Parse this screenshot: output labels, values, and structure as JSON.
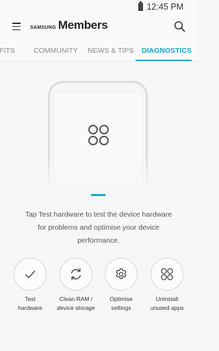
{
  "status_bar": {
    "time": "12:45 PM",
    "battery_icon": "battery-icon"
  },
  "app_bar": {
    "brand_small": "SAMSUNG",
    "brand_big": "Members",
    "menu_icon": "menu-icon",
    "search_icon": "search-icon"
  },
  "tabs": [
    {
      "label": "EFITS",
      "active": false
    },
    {
      "label": "COMMUNITY",
      "active": false
    },
    {
      "label": "NEWS & TIPS",
      "active": false
    },
    {
      "label": "DIAGNOSTICS",
      "active": true
    }
  ],
  "colors": {
    "accent": "#1ba8c8"
  },
  "main": {
    "illustration_icon": "apps-grid-icon",
    "description": "Tap Test hardware to test the device hardware for problems and optimise your device performance."
  },
  "actions": [
    {
      "icon": "check-icon",
      "label_lines": [
        "Test",
        "hardware"
      ]
    },
    {
      "icon": "refresh-icon",
      "label_lines": [
        "Clean RAM /",
        "device storage"
      ]
    },
    {
      "icon": "gear-icon",
      "label_lines": [
        "Optimise",
        "settings"
      ]
    },
    {
      "icon": "apps-grid-icon",
      "label_lines": [
        "Uninstall",
        "unused apps"
      ]
    }
  ]
}
